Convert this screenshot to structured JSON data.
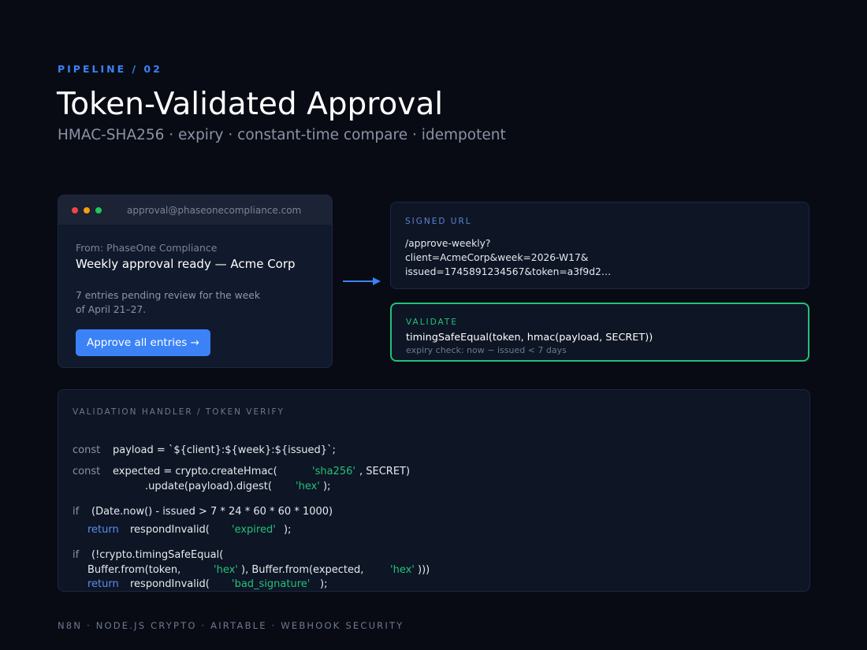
{
  "header": {
    "eyebrow": "PIPELINE / 02",
    "title": "Token-Validated Approval",
    "subtitle": "HMAC-SHA256 · expiry · constant-time compare · idempotent"
  },
  "email": {
    "address": "approval@phaseonecompliance.com",
    "from": "From: PhaseOne Compliance",
    "subject": "Weekly approval ready — Acme Corp",
    "body": "7 entries pending review for the week of April 21–27.",
    "button_label": "Approve all entries →",
    "window_dots": [
      "#ef4444",
      "#f59e0b",
      "#22c55e"
    ]
  },
  "signed_url": {
    "label": "SIGNED URL",
    "lines": [
      "/approve-weekly?",
      "client=AcmeCorp&week=2026-W17&",
      "issued=1745891234567&token=a3f9d2…"
    ]
  },
  "validate": {
    "label": "VALIDATE",
    "code": "timingSafeEqual(token, hmac(payload, SECRET))",
    "note": "expiry check: now − issued < 7 days"
  },
  "code_panel": {
    "title": "VALIDATION HANDLER / TOKEN VERIFY",
    "l1_kw": "const",
    "l1_rest": "payload = `${client}:${week}:${issued}`;",
    "l2_kw": "const",
    "l2_rest": "expected = crypto.createHmac(",
    "l2_str": "'sha256'",
    "l2_end": ", SECRET)",
    "l3_rest": ".update(payload).digest(",
    "l3_str": "'hex'",
    "l3_end": ");",
    "l4_kw": "if",
    "l4_rest": "(Date.now() - issued > 7 * 24 * 60 * 60 * 1000)",
    "l5_kw": "return",
    "l5_rest": "respondInvalid(",
    "l5_str": "'expired'",
    "l5_end": ");",
    "l6_kw": "if",
    "l6_rest": "(!crypto.timingSafeEqual(",
    "l7_rest": "Buffer.from(token,",
    "l7_str": "'hex'",
    "l7_mid": "), Buffer.from(expected,",
    "l7_str2": "'hex'",
    "l7_end": ")))",
    "l8_kw": "return",
    "l8_rest": "respondInvalid(",
    "l8_str": "'bad_signature'",
    "l8_end": ");"
  },
  "footer": "N8N · NODE.JS CRYPTO · AIRTABLE · WEBHOOK SECURITY",
  "colors": {
    "accent": "#3b82f6",
    "success": "#22c17a",
    "background": "#080b14"
  }
}
